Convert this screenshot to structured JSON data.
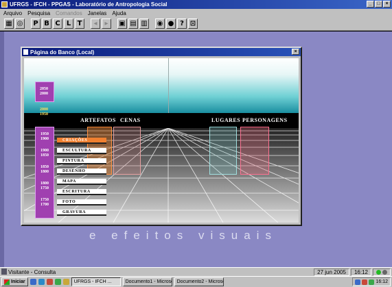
{
  "app": {
    "title": "UFRGS - IFCH - PPGAS - Laboratório de Antropologia Social"
  },
  "menu": [
    {
      "label": "Arquivo",
      "enabled": true
    },
    {
      "label": "Pesquisa",
      "enabled": true
    },
    {
      "label": "Comandos",
      "enabled": false
    },
    {
      "label": "Janelas",
      "enabled": true
    },
    {
      "label": "Ajuda",
      "enabled": true
    }
  ],
  "toolbar": {
    "letters": [
      "P",
      "B",
      "C",
      "L",
      "T"
    ]
  },
  "child_window": {
    "title": "Página do Banco (Local)"
  },
  "scene": {
    "categories": {
      "artefatos": "ARTEFATOS",
      "cenas": "CENAS",
      "lugares": "LUGARES",
      "personagens": "PERSONAGENS"
    },
    "eras": [
      {
        "label": "2050\n2000"
      },
      {
        "label": "2000\n1950"
      },
      {
        "label": "1950\n1900"
      },
      {
        "label": "1900\n1850"
      },
      {
        "label": "1850\n1800"
      },
      {
        "label": "1800\n1750"
      },
      {
        "label": "1750\n1700"
      }
    ],
    "menu_items": [
      "CRIAÇÕES",
      "ESCULTURA",
      "PINTURA",
      "DESENHO",
      "MAPA",
      "ESCRITURA",
      "FOTO",
      "GRAVURA"
    ],
    "active_item": "CRIAÇÕES"
  },
  "caption": "e efeitos visuais",
  "status": {
    "user": "Visitante - Consulta",
    "date": "27 jun 2005",
    "time": "16:12"
  },
  "taskbar": {
    "start_label": "Iniciar",
    "tasks": [
      "UFRGS - IFCH ...",
      "Documento1 - Microsof...",
      "Documento2 - Microsof..."
    ],
    "clock": "16:12",
    "colors": {
      "accent": "#0a1a7a",
      "desktop": "#8a88c4"
    }
  }
}
